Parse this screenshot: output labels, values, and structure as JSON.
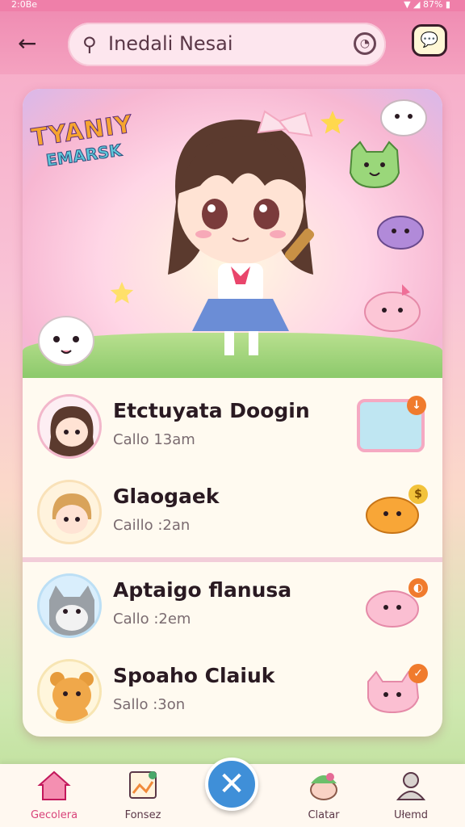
{
  "statusbar": {
    "time": "2:0Be",
    "signal": "▼ ◢ 87% ▮"
  },
  "appbar": {
    "back_icon": "←",
    "search_query": "Inedali Nesai",
    "clear_icon": "◔",
    "chat_icon": "💬"
  },
  "banner": {
    "title_line1": "TYANIY",
    "title_line2": "EMARSK"
  },
  "contacts": [
    {
      "name": "Etctuyata Doogin",
      "meta": "Callo 13am"
    },
    {
      "name": "Glaogaek",
      "meta": "Caillo :2an"
    },
    {
      "name": "Aptaigo flanusa",
      "meta": "Callo :2em"
    },
    {
      "name": "Spoaho Claiuk",
      "meta": "Sallo :3on"
    }
  ],
  "nav": {
    "items": [
      {
        "label": "Gecolera"
      },
      {
        "label": "Fonsez"
      },
      {
        "label": "Clatar"
      },
      {
        "label": "Ułemd"
      }
    ],
    "fab_icon": "✕"
  },
  "colors": {
    "accent_pink": "#f08db3",
    "fab_blue": "#3f8fd8",
    "badge_orange": "#f07b2d"
  }
}
